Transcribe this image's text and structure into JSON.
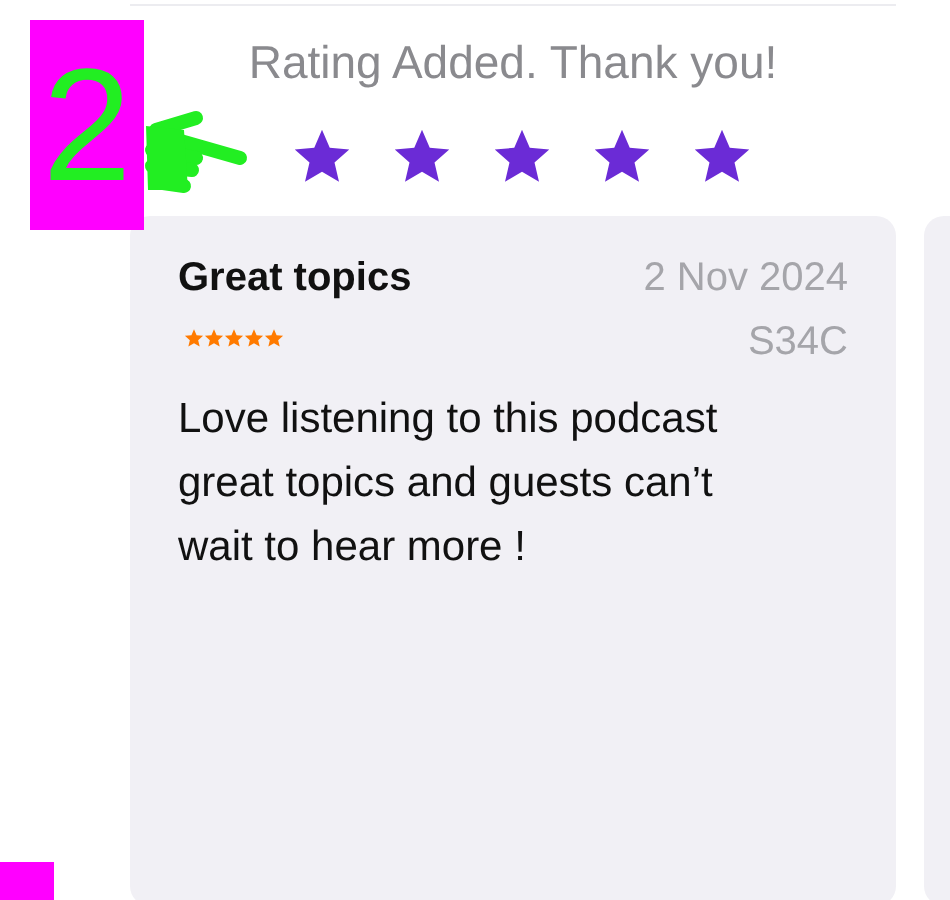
{
  "annotation": {
    "label": "2"
  },
  "rating_prompt": {
    "message": "Rating Added. Thank you!",
    "stars": 5
  },
  "reviews": [
    {
      "title": "Great topics",
      "stars": 5,
      "date": "2 Nov 2024",
      "author": "S34C",
      "body": "Love listening to this podcast great topics and guests can’t wait to hear more !"
    }
  ]
}
